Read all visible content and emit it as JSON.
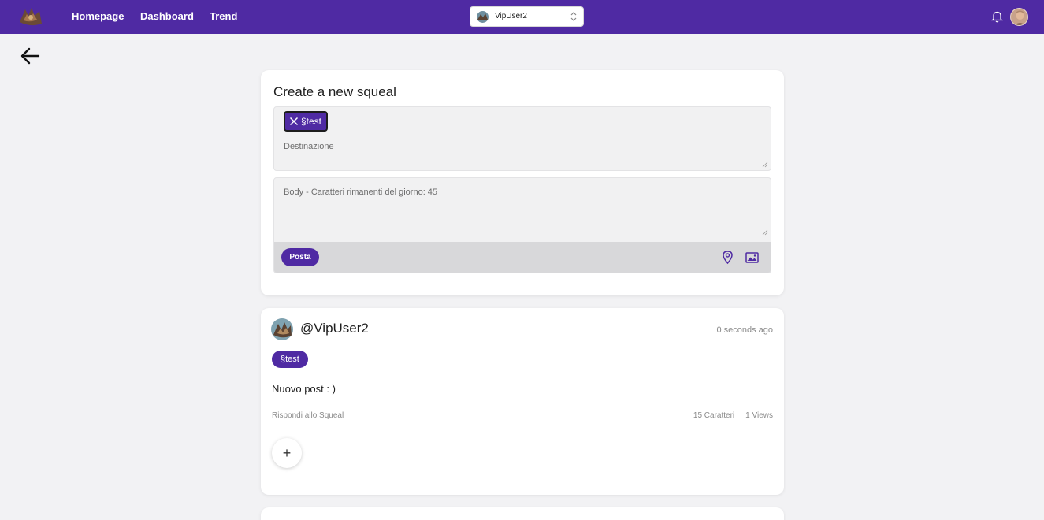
{
  "nav": {
    "links": [
      "Homepage",
      "Dashboard",
      "Trend"
    ],
    "account_select": "VipUser2"
  },
  "create": {
    "title": "Create a new squeal",
    "selected_destination": "§test",
    "destination_placeholder": "Destinazione",
    "body_placeholder": "Body - Caratteri rimanenti del giorno: 45",
    "post_label": "Posta"
  },
  "post": {
    "username": "@VipUser2",
    "time": "0 seconds ago",
    "tag": "§test",
    "body": "Nuovo post : )",
    "reply_label": "Rispondi allo Squeal",
    "characters": "15 Caratteri",
    "views": "1 Views",
    "add_label": "+"
  },
  "colors": {
    "brand": "#4f2aa3",
    "background": "#f2f2f4"
  },
  "icons": [
    "logo-icon",
    "chevron-updown-icon",
    "bell-icon",
    "back-arrow-icon",
    "close-icon",
    "location-pin-icon",
    "image-icon"
  ]
}
